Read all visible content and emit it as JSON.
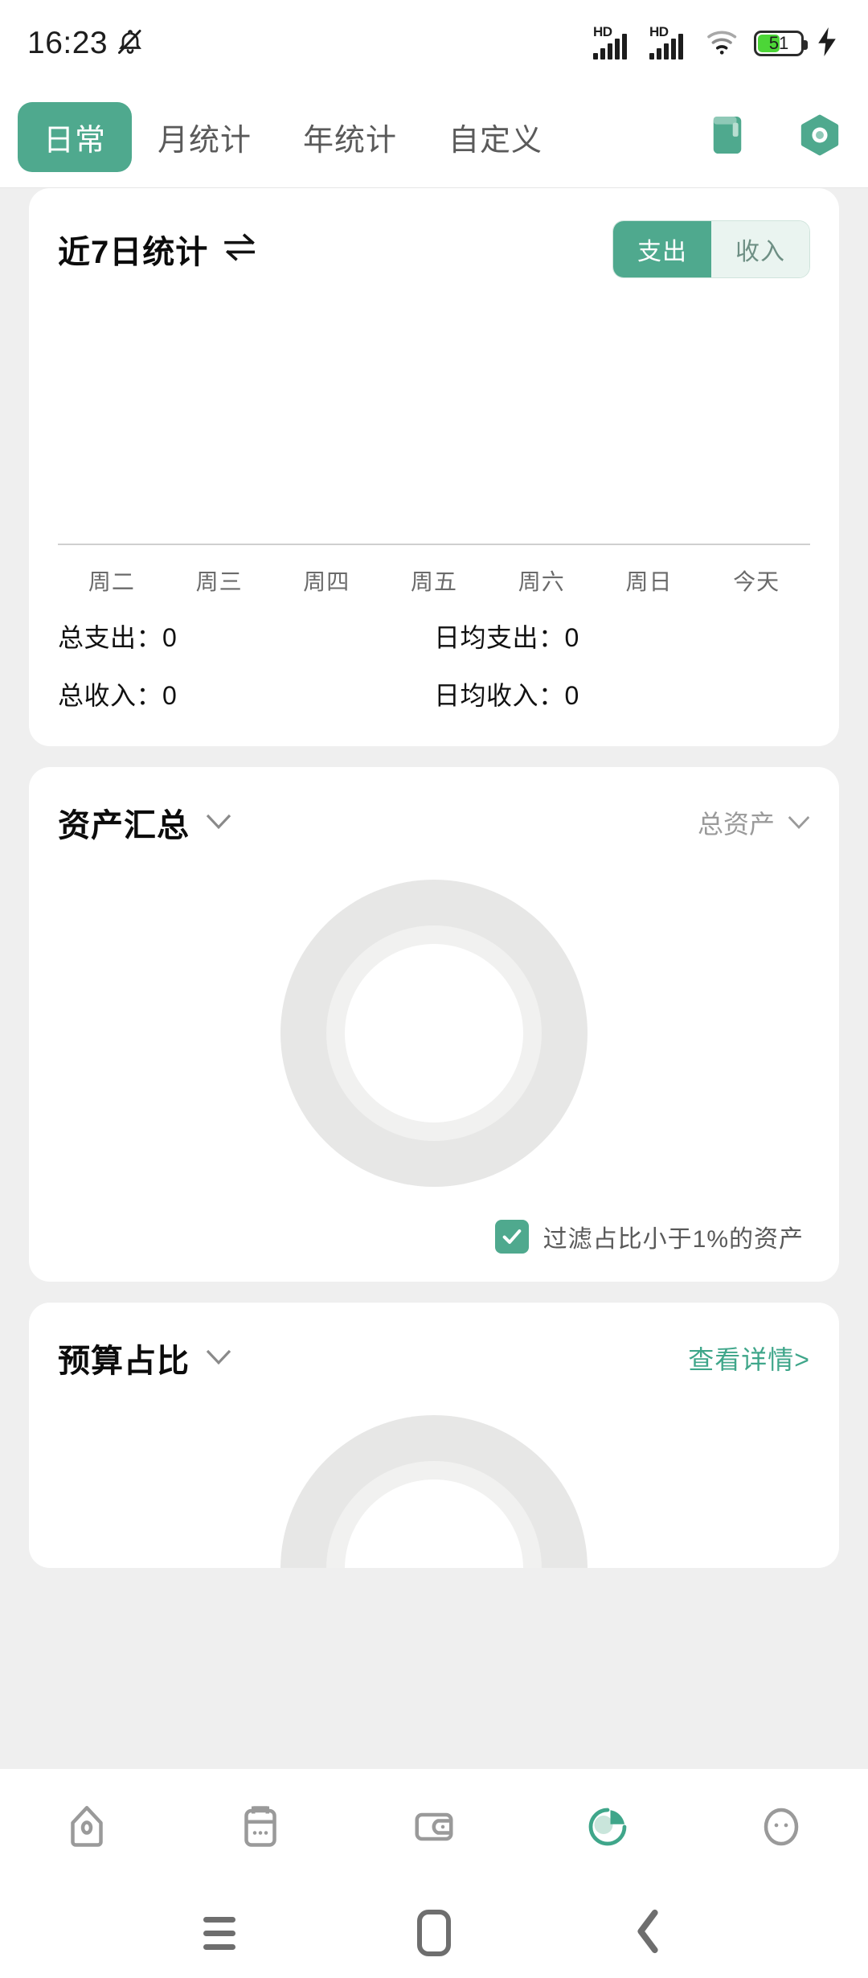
{
  "status_bar": {
    "time": "16:23",
    "mute_icon": "bell-mute-icon",
    "signal_1_label": "HD",
    "signal_2_label": "HD",
    "wifi_icon": "wifi-icon",
    "battery_percent": "51",
    "battery_level": 51,
    "charging_icon": "charging-bolt-icon"
  },
  "tabbar": {
    "tabs": [
      {
        "label": "日常",
        "active": true
      },
      {
        "label": "月统计",
        "active": false
      },
      {
        "label": "年统计",
        "active": false
      },
      {
        "label": "自定义",
        "active": false
      }
    ],
    "ledger_icon": "book-ledger-icon",
    "settings_icon": "hex-gear-icon"
  },
  "weekly_card": {
    "title": "近7日统计",
    "swap_icon": "swap-arrows-icon",
    "toggle": {
      "expense_label": "支出",
      "income_label": "收入",
      "selected": "支出"
    },
    "stats": [
      {
        "label": "总支出：0",
        "label2": "日均支出：0"
      },
      {
        "label": "总收入：0",
        "label2": "日均收入：0"
      }
    ],
    "total_expense": "总支出：0",
    "avg_expense": "日均支出：0",
    "total_income": "总收入：0",
    "avg_income": "日均收入：0"
  },
  "assets_card": {
    "title": "资产汇总",
    "caret_icon": "chevron-down-icon",
    "selector_label": "总资产",
    "selector_caret_icon": "chevron-down-icon",
    "filter_label": "过滤占比小于1%的资产",
    "filter_checked": true
  },
  "budget_card": {
    "title": "预算占比",
    "caret_icon": "chevron-down-icon",
    "detail_link": "查看详情>"
  },
  "bottom_nav": [
    {
      "icon": "home-icon",
      "active": false
    },
    {
      "icon": "calendar-icon",
      "active": false
    },
    {
      "icon": "wallet-icon",
      "active": false
    },
    {
      "icon": "pie-chart-icon",
      "active": true
    },
    {
      "icon": "more-face-icon",
      "active": false
    }
  ],
  "system_nav": [
    {
      "icon": "recents-menu-icon"
    },
    {
      "icon": "home-square-icon"
    },
    {
      "icon": "back-chevron-icon"
    }
  ],
  "colors": {
    "accent": "#4FA98E",
    "accent_light": "#EAF4F0",
    "page_bg": "#EFEFEF",
    "card_bg": "#FFFFFF",
    "donut_outer": "#E7E7E6",
    "donut_inner": "#F1F1F0",
    "battery_green": "#4CD637"
  },
  "chart_data": {
    "type": "bar",
    "title": "近7日统计",
    "categories": [
      "周二",
      "周三",
      "周四",
      "周五",
      "周六",
      "周日",
      "今天"
    ],
    "series": [
      {
        "name": "支出",
        "values": [
          0,
          0,
          0,
          0,
          0,
          0,
          0
        ]
      }
    ],
    "values": [
      0,
      0,
      0,
      0,
      0,
      0,
      0
    ],
    "xlabel": "",
    "ylabel": "",
    "ylim": [
      0,
      0
    ],
    "grid": false,
    "legend": "none"
  }
}
